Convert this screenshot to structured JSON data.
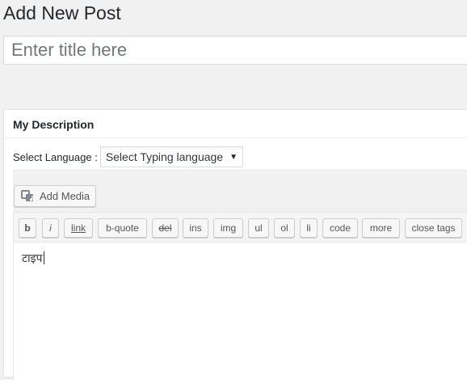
{
  "page": {
    "title": "Add New Post"
  },
  "title_field": {
    "placeholder": "Enter title here",
    "value": ""
  },
  "metabox": {
    "title": "My Description",
    "language_label": "Select Language :",
    "language_select": {
      "selected": "Select Typing language"
    }
  },
  "editor": {
    "add_media_label": "Add Media",
    "quicktags": [
      {
        "label": "b",
        "name": "qt-bold-button"
      },
      {
        "label": "i",
        "name": "qt-italic-button"
      },
      {
        "label": "link",
        "name": "qt-link-button"
      },
      {
        "label": "b-quote",
        "name": "qt-blockquote-button"
      },
      {
        "label": "del",
        "name": "qt-del-button"
      },
      {
        "label": "ins",
        "name": "qt-ins-button"
      },
      {
        "label": "img",
        "name": "qt-img-button"
      },
      {
        "label": "ul",
        "name": "qt-ul-button"
      },
      {
        "label": "ol",
        "name": "qt-ol-button"
      },
      {
        "label": "li",
        "name": "qt-li-button"
      },
      {
        "label": "code",
        "name": "qt-code-button"
      },
      {
        "label": "more",
        "name": "qt-more-button"
      },
      {
        "label": "close tags",
        "name": "qt-close-tags-button"
      }
    ],
    "content": "टाइप"
  }
}
